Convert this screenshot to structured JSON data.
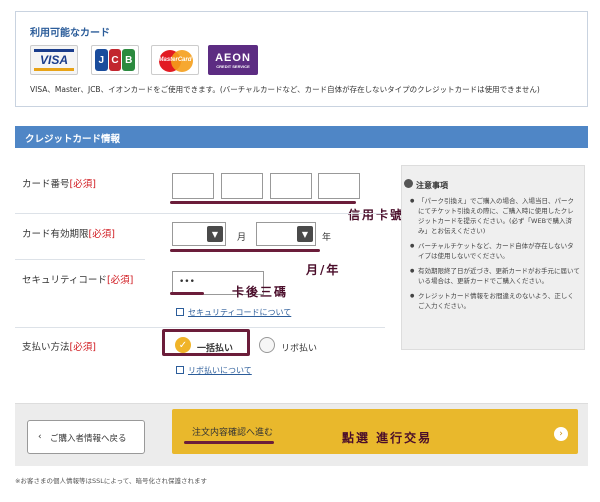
{
  "cards": {
    "title": "利用可能なカード",
    "logos": [
      {
        "name": "VISA"
      },
      {
        "name": "JCB"
      },
      {
        "name": "MasterCard"
      },
      {
        "name": "AEON",
        "sub": "CREDIT SERVICE"
      }
    ],
    "note": "VISA、Master、JCB、イオンカードをご使用できます。(バーチャルカードなど、カード自体が存在しないタイプのクレジットカードは使用できません)"
  },
  "section": {
    "title": "クレジットカード情報"
  },
  "required_mark": "[必須]",
  "form": {
    "card_number_label": "カード番号",
    "expiry_label": "カード有効期限",
    "expiry_month_unit": "月",
    "expiry_year_unit": "年",
    "security_label": "セキュリティコード",
    "security_value": "•••",
    "security_link": "セキュリティコードについて",
    "payment_label": "支払い方法",
    "payment_option_1": "一括払い",
    "payment_option_2": "リボ払い",
    "payment_link": "リボ払いについて"
  },
  "annotations": {
    "card_number": "信用卡號",
    "expiry": "月/年",
    "security": "卡後三碼",
    "confirm": "點選 進行交易"
  },
  "notice": {
    "title": "注意事項",
    "items": [
      "「パーク引換え」でご購入の場合、入場当日、パークにてチケット引換えの際に、ご購入時に使用したクレジットカードを提示ください。(必ず「WEBで購入済み」とお伝えください)",
      "バーチャルチケットなど、カード自体が存在しないタイプは使用しないでください。",
      "有効期限終了日が近づき、更新カードがお手元に届いている場合は、更新カードでご購入ください。",
      "クレジットカード情報をお間違えのないよう、正しくご入力ください。"
    ]
  },
  "buttons": {
    "back": "ご購入者情報へ戻る",
    "confirm": "注文内容確認へ進む"
  },
  "footnote": "※お客さまの個人情報等はSSLによって、暗号化され保護されます"
}
